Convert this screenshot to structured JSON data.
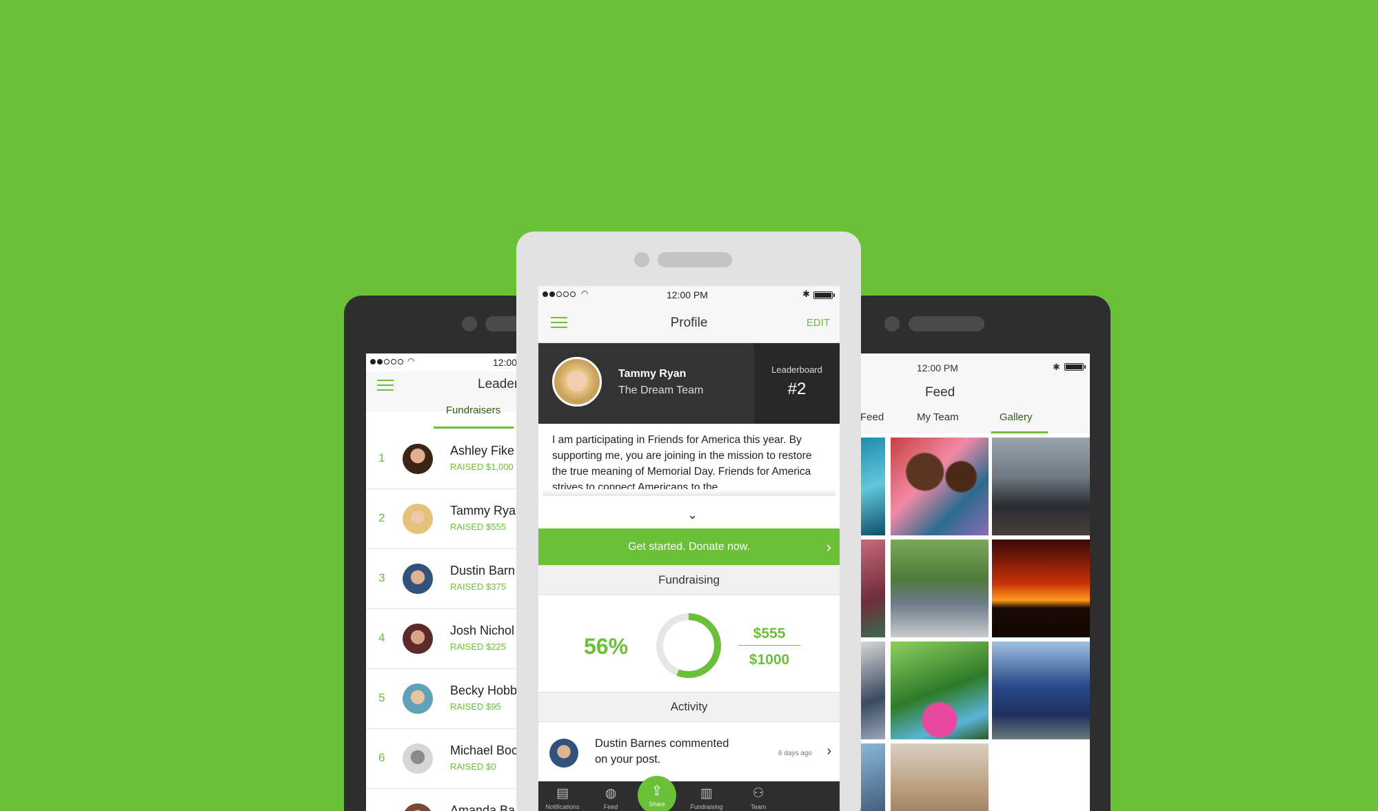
{
  "colors": {
    "background": "#6bc03a",
    "accent": "#6bc03a",
    "dark": "#333333"
  },
  "status_bar": {
    "time": "12:00 PM",
    "wifi_icon": "wifi-icon",
    "bluetooth_icon": "bluetooth-icon"
  },
  "left_phone": {
    "status_time": "12:00",
    "title": "Leader",
    "tab": "Fundraisers",
    "rows": [
      {
        "rank": "1",
        "name": "Ashley Fike",
        "raised": "RAISED $1,000"
      },
      {
        "rank": "2",
        "name": "Tammy Rya",
        "raised": "RAISED $555"
      },
      {
        "rank": "3",
        "name": "Dustin Barn",
        "raised": "RAISED $375"
      },
      {
        "rank": "4",
        "name": "Josh Nichol",
        "raised": "RAISED $225"
      },
      {
        "rank": "5",
        "name": "Becky Hobb",
        "raised": "RAISED $95"
      },
      {
        "rank": "6",
        "name": "Michael Boc",
        "raised": "RAISED $0"
      },
      {
        "rank": "7",
        "name": "Amanda Ba",
        "raised": ""
      }
    ]
  },
  "center_phone": {
    "title": "Profile",
    "edit_label": "EDIT",
    "profile": {
      "name": "Tammy Ryan",
      "team": "The Dream Team",
      "leaderboard_label": "Leaderboard",
      "leaderboard_rank": "#2"
    },
    "bio": "I am participating in Friends for America this year. By supporting me, you are joining in the mission to restore the true meaning of Memorial Day. Friends for America strives to connect Americans to the",
    "donate_label": "Get started. Donate now.",
    "fundraising": {
      "section_title": "Fundraising",
      "percent_text": "56%",
      "progress_fraction": 0.56,
      "raised": "$555",
      "goal": "$1000"
    },
    "activity": {
      "section_title": "Activity",
      "text": "Dustin Barnes commented on your post.",
      "time": "6 days ago"
    },
    "tabs": [
      {
        "label": "Notifications",
        "icon": "list-icon"
      },
      {
        "label": "Feed",
        "icon": "globe-icon"
      },
      {
        "label": "Share",
        "icon": "share-icon"
      },
      {
        "label": "Fundraising",
        "icon": "bar-chart-icon"
      },
      {
        "label": "Team",
        "icon": "team-icon"
      }
    ]
  },
  "right_phone": {
    "status_time": "12:00 PM",
    "title": "Feed",
    "tabs": [
      "Feed",
      "My Team",
      "Gallery"
    ],
    "active_tab": "Gallery"
  }
}
